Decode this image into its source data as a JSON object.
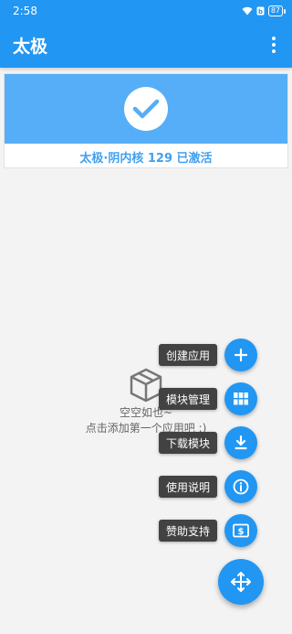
{
  "status_bar": {
    "time": "2:58",
    "battery": "87"
  },
  "app_bar": {
    "title": "太极"
  },
  "status_card": {
    "status_text": "太极·阴内核 129 已激活"
  },
  "empty_state": {
    "title": "空空如也~",
    "subtitle": "点击添加第一个应用吧 :)"
  },
  "fab_menu": {
    "items": [
      {
        "label": "创建应用",
        "icon": "plus-icon"
      },
      {
        "label": "模块管理",
        "icon": "grid-icon"
      },
      {
        "label": "下载模块",
        "icon": "download-icon"
      },
      {
        "label": "使用说明",
        "icon": "info-icon"
      },
      {
        "label": "赞助支持",
        "icon": "dollar-icon"
      }
    ],
    "main_icon": "move-arrows-icon"
  },
  "colors": {
    "primary": "#2196f3",
    "card_header": "#55aef7",
    "label_bg": "#424242"
  }
}
